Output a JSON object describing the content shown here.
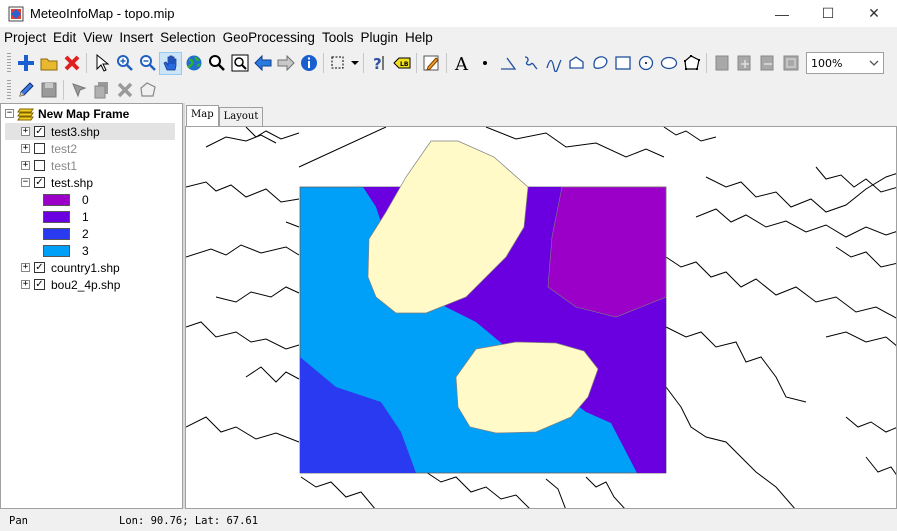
{
  "window": {
    "title": "MeteoInfoMap - topo.mip",
    "minimize": "—",
    "maximize": "☐",
    "close": "✕"
  },
  "menu": [
    "Project",
    "Edit",
    "View",
    "Insert",
    "Selection",
    "GeoProcessing",
    "Tools",
    "Plugin",
    "Help"
  ],
  "toolbar": {
    "zoom_value": "100%"
  },
  "tree": {
    "root": "New Map Frame",
    "layers": [
      {
        "name": "test3.shp",
        "checked": true,
        "expanded": false,
        "selected": true
      },
      {
        "name": "test2",
        "checked": false,
        "expanded": false
      },
      {
        "name": "test1",
        "checked": false,
        "expanded": false
      },
      {
        "name": "test.shp",
        "checked": true,
        "expanded": true
      },
      {
        "name": "country1.shp",
        "checked": true,
        "expanded": false
      },
      {
        "name": "bou2_4p.shp",
        "checked": true,
        "expanded": false
      }
    ],
    "legend": [
      {
        "label": "0",
        "color": "#9a00c8"
      },
      {
        "label": "1",
        "color": "#6a00e0"
      },
      {
        "label": "2",
        "color": "#2a3af0"
      },
      {
        "label": "3",
        "color": "#00a0f8"
      }
    ]
  },
  "tabs": [
    "Map",
    "Layout"
  ],
  "map": {
    "contour_fill": "#fffac8"
  },
  "status": {
    "mode": "Pan",
    "coords": "Lon: 90.76; Lat: 67.61"
  }
}
